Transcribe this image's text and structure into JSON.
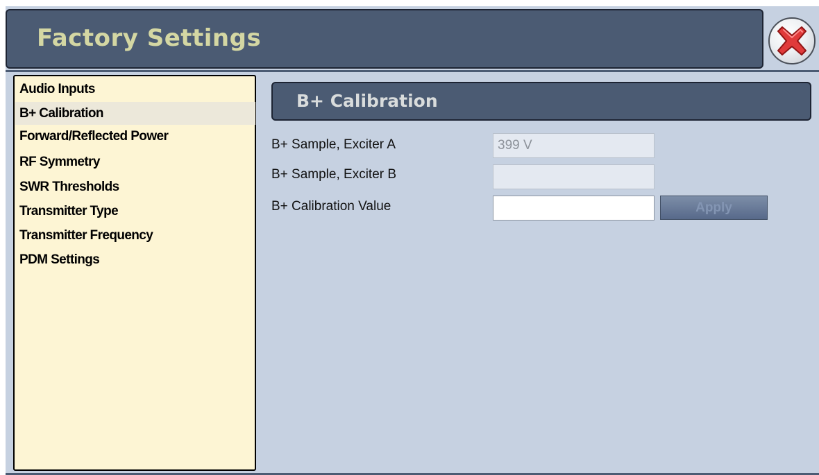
{
  "window": {
    "title": "Factory Settings"
  },
  "sidebar": {
    "items": [
      {
        "label": "Audio Inputs",
        "selected": false
      },
      {
        "label": "B+ Calibration",
        "selected": true
      },
      {
        "label": "Forward/Reflected Power",
        "selected": false
      },
      {
        "label": "RF Symmetry",
        "selected": false
      },
      {
        "label": "SWR Thresholds",
        "selected": false
      },
      {
        "label": "Transmitter Type",
        "selected": false
      },
      {
        "label": "Transmitter Frequency",
        "selected": false
      },
      {
        "label": "PDM Settings",
        "selected": false
      }
    ]
  },
  "main": {
    "section_title": "B+ Calibration",
    "fields": [
      {
        "label": "B+ Sample, Exciter A",
        "value": "399 V",
        "readonly": true
      },
      {
        "label": "B+ Sample, Exciter B",
        "value": "",
        "readonly": true
      },
      {
        "label": "B+ Calibration Value",
        "value": "",
        "readonly": false
      }
    ],
    "apply_label": "Apply"
  },
  "icons": {
    "close": "close-x-icon"
  },
  "colors": {
    "header_bg": "#4b5b73",
    "title_text": "#d4d7a3",
    "panel_bg": "#c6d1e1",
    "sidebar_bg": "#fdf5d4",
    "close_red": "#e03a3a"
  }
}
